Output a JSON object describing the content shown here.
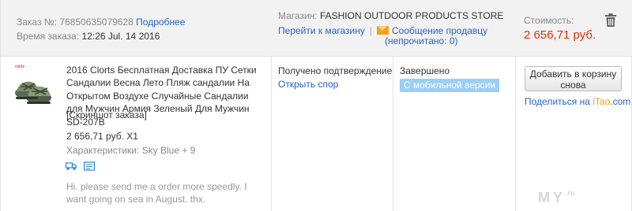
{
  "header": {
    "order_label": "Заказ №:",
    "order_number": "76850635079628",
    "details_link": "Подробнее",
    "time_label": "Время заказа:",
    "time_value": "12:26 Jul. 14 2016",
    "store_label": "Магазин:",
    "store_name": "FASHION OUTDOOR PRODUCTS STORE",
    "go_to_store": "Перейти к магазину",
    "separator": "|",
    "message_seller": "Сообщение продавцу",
    "unread_prefix": "(непрочитано: ",
    "unread_count": "0",
    "unread_suffix": ")",
    "cost_label": "Стоимость:",
    "cost_value": "2 656,71 руб."
  },
  "item": {
    "thumb_brand": "clorts",
    "title": "2016 Clorts Бесплатная Доставка ПУ Сетки Сандалии Весна Лето Пляж сандалии На Открытом Воздухе Случайные Сандалии для Мужчин Армия Зеленый Для Мужчин SD-207B",
    "screenshot_link": "[Скриншот заказа]",
    "price": "2 656,71 руб. X1",
    "characteristics": "Характеристики: Sky Blue + 9",
    "note": "Hi. please send me a order more speedly. I want going on sea in August. thx."
  },
  "status": {
    "received": "Получено подтверждение",
    "open_dispute": "Открыть спор",
    "completed": "Завершено",
    "mobile_badge": "С мобильной версии"
  },
  "actions": {
    "add_to_cart": "Добавить в корзину снова",
    "share_prefix": "Поделиться на ",
    "share_site_prefix": "iTao",
    "share_site_suffix": ".com"
  },
  "watermark": {
    "text": "MY",
    "suffix": ".ru"
  },
  "colors": {
    "link": "#2463c6",
    "price_red": "#e62e04",
    "badge_blue": "#9ccdf5",
    "itao_orange": "#f29b1a"
  },
  "icons": [
    "trash-icon",
    "envelope-icon",
    "delivery-truck-icon",
    "invoice-icon"
  ]
}
